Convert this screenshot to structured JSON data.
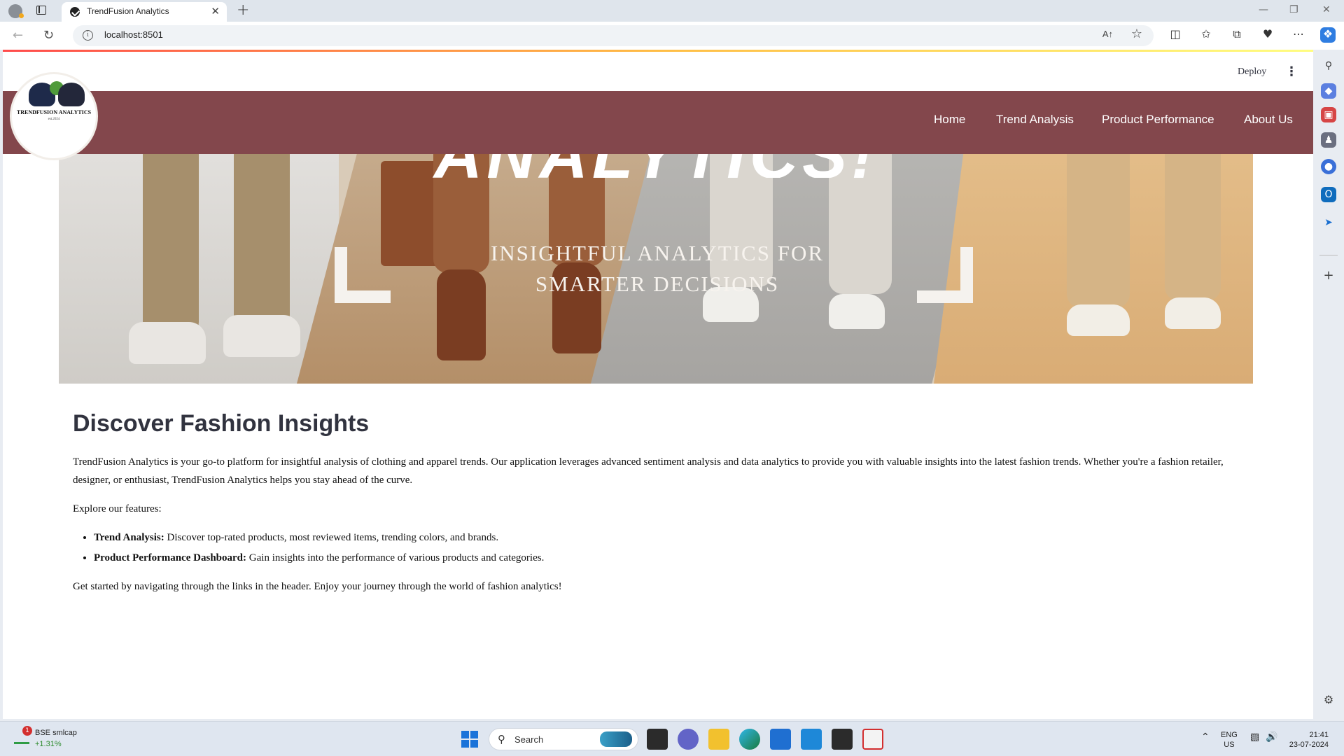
{
  "browser": {
    "tab_title": "TrendFusion Analytics",
    "url": "localhost:8501",
    "read_aloud": "A↑",
    "close_glyph": "✕",
    "new_tab_glyph": "+",
    "window_controls": [
      "—",
      "❐",
      "✕"
    ]
  },
  "streamlit": {
    "deploy_label": "Deploy",
    "menu_glyph": "⋮"
  },
  "header": {
    "logo_text": "TRENDFUSION ANALYTICS",
    "logo_est": "est.2024",
    "nav": [
      "Home",
      "Trend Analysis",
      "Product Performance",
      "About Us"
    ],
    "brand_color": "#83474c"
  },
  "hero": {
    "word": "ANALYTICS!",
    "subtitle": "INSIGHTFUL ANALYTICS FOR SMARTER DECISIONS"
  },
  "main": {
    "heading": "Discover Fashion Insights",
    "intro": "TrendFusion Analytics is your go-to platform for insightful analysis of clothing and apparel trends. Our application leverages advanced sentiment analysis and data analytics to provide you with valuable insights into the latest fashion trends. Whether you're a fashion retailer, designer, or enthusiast, TrendFusion Analytics helps you stay ahead of the curve.",
    "features_lead": "Explore our features:",
    "features": [
      {
        "title": "Trend Analysis:",
        "text": " Discover top-rated products, most reviewed items, trending colors, and brands."
      },
      {
        "title": "Product Performance Dashboard:",
        "text": " Gain insights into the performance of various products and categories."
      }
    ],
    "outro": "Get started by navigating through the links in the header. Enjoy your journey through the world of fashion analytics!"
  },
  "taskbar": {
    "stock_name": "BSE smlcap",
    "stock_change": "+1.31%",
    "stock_badge": "1",
    "search_label": "Search",
    "lang_top": "ENG",
    "lang_bottom": "US",
    "time": "21:41",
    "date": "23-07-2024"
  }
}
